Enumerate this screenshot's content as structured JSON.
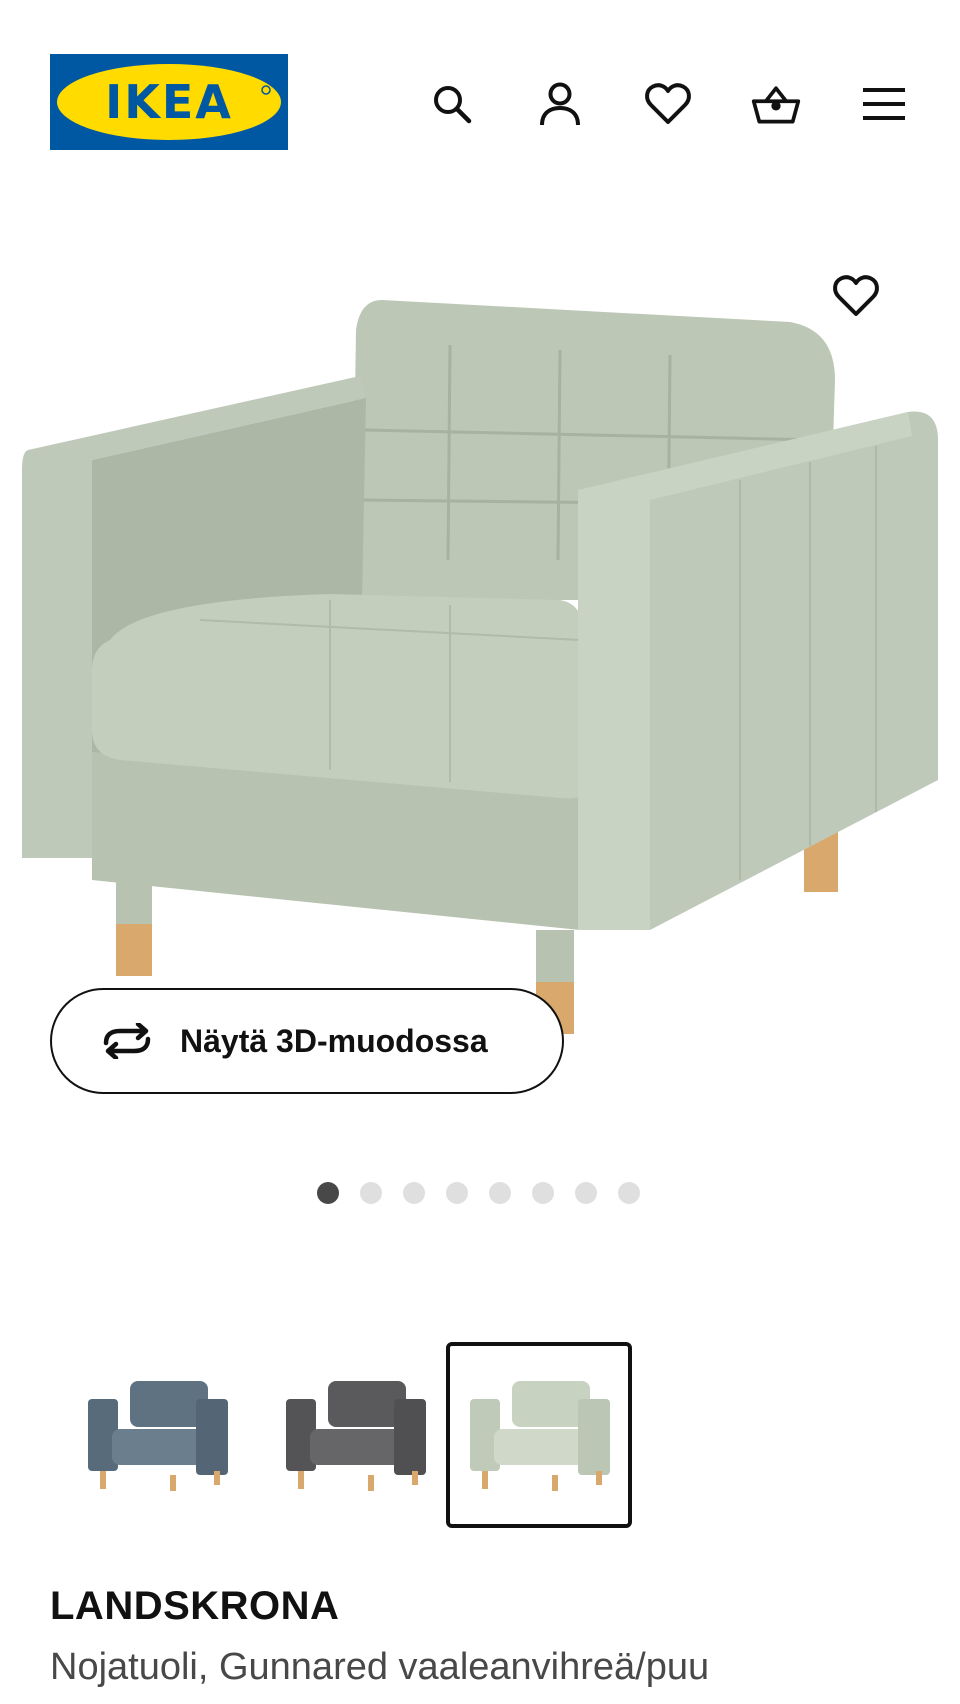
{
  "header": {
    "logo_text": "IKEA",
    "icons": [
      "search-icon",
      "account-icon",
      "heart-icon",
      "basket-icon",
      "menu-icon"
    ]
  },
  "gallery": {
    "view_3d_label": "Näytä 3D-muodossa",
    "image_count": 8,
    "active_image": 1
  },
  "variants": [
    {
      "color": "#5f7281"
    },
    {
      "color": "#5a5a5c"
    },
    {
      "color": "#c8d2c1",
      "selected": true
    }
  ],
  "product": {
    "name": "LANDSKRONA",
    "description": "Nojatuoli, Gunnared vaaleanvihreä/puu"
  },
  "colors": {
    "brand_blue": "#0058a3",
    "brand_yellow": "#ffdb00",
    "text": "#111111",
    "muted": "#484848"
  }
}
